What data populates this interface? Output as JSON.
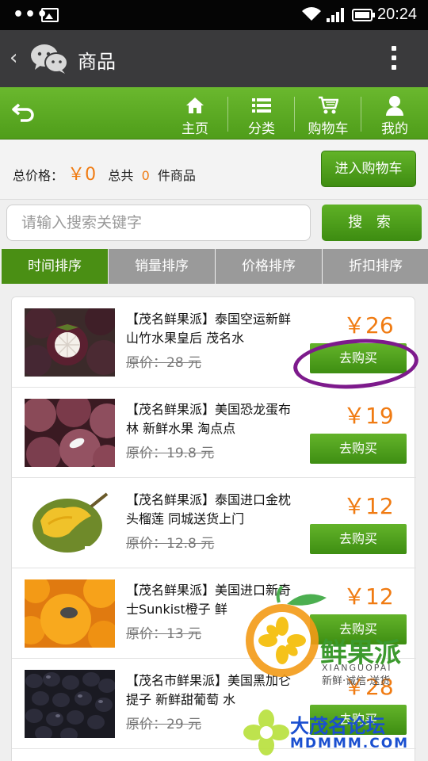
{
  "status_bar": {
    "dots": "•••",
    "time": "20:24",
    "icons": [
      "gallery-icon",
      "wifi-icon",
      "signal-icon",
      "battery-icon"
    ]
  },
  "titlebar": {
    "back_icon": "chevron-left-icon",
    "title": "商品",
    "more_icon": "more-vertical-icon"
  },
  "nav": {
    "return_icon": "return-arrow-icon",
    "items": [
      {
        "label": "主页",
        "icon": "home-icon"
      },
      {
        "label": "分类",
        "icon": "list-icon"
      },
      {
        "label": "购物车",
        "icon": "cart-icon"
      },
      {
        "label": "我的",
        "icon": "user-icon"
      }
    ]
  },
  "summary": {
    "total_label": "总价格：",
    "total_value": "￥0",
    "count_prefix": "总共",
    "count_value": "0",
    "count_suffix": "件商品",
    "cart_button": "进入购物车"
  },
  "search": {
    "placeholder": "请输入搜索关键字",
    "button": "搜 索"
  },
  "sort_tabs": [
    {
      "label": "时间排序",
      "active": true
    },
    {
      "label": "销量排序",
      "active": false
    },
    {
      "label": "价格排序",
      "active": false
    },
    {
      "label": "折扣排序",
      "active": false
    }
  ],
  "products": [
    {
      "name": "【茂名鲜果派】泰国空运新鲜山竹水果皇后 茂名水",
      "original": "原价：28 元",
      "price": "￥26",
      "buy": "去购买"
    },
    {
      "name": "【茂名鲜果派】美国恐龙蛋布林 新鲜水果 淘点点",
      "original": "原价：19.8 元",
      "price": "￥19",
      "buy": "去购买"
    },
    {
      "name": "【茂名鲜果派】泰国进口金枕头榴莲 同城送货上门",
      "original": "原价：12.8 元",
      "price": "￥12",
      "buy": "去购买"
    },
    {
      "name": "【茂名鲜果派】美国进口新奇士Sunkist橙子 鲜",
      "original": "原价：13 元",
      "price": "￥12",
      "buy": "去购买"
    },
    {
      "name": "【茂名市鲜果派】美国黑加仑提子 新鲜甜葡萄 水",
      "original": "原价：29 元",
      "price": "￥28",
      "buy": "去购买"
    }
  ],
  "watermarks": {
    "brand_cn": "鲜果派",
    "brand_pinyin": "XIANGUOPAI",
    "brand_slogan": "新鲜·诚信·送货",
    "forum_cn": "大茂名论坛",
    "forum_url": "MDMMM.COM"
  },
  "colors": {
    "accent_green": "#4f9d1a",
    "price_orange": "#f07b12",
    "annotation_purple": "#7d1a8c"
  }
}
